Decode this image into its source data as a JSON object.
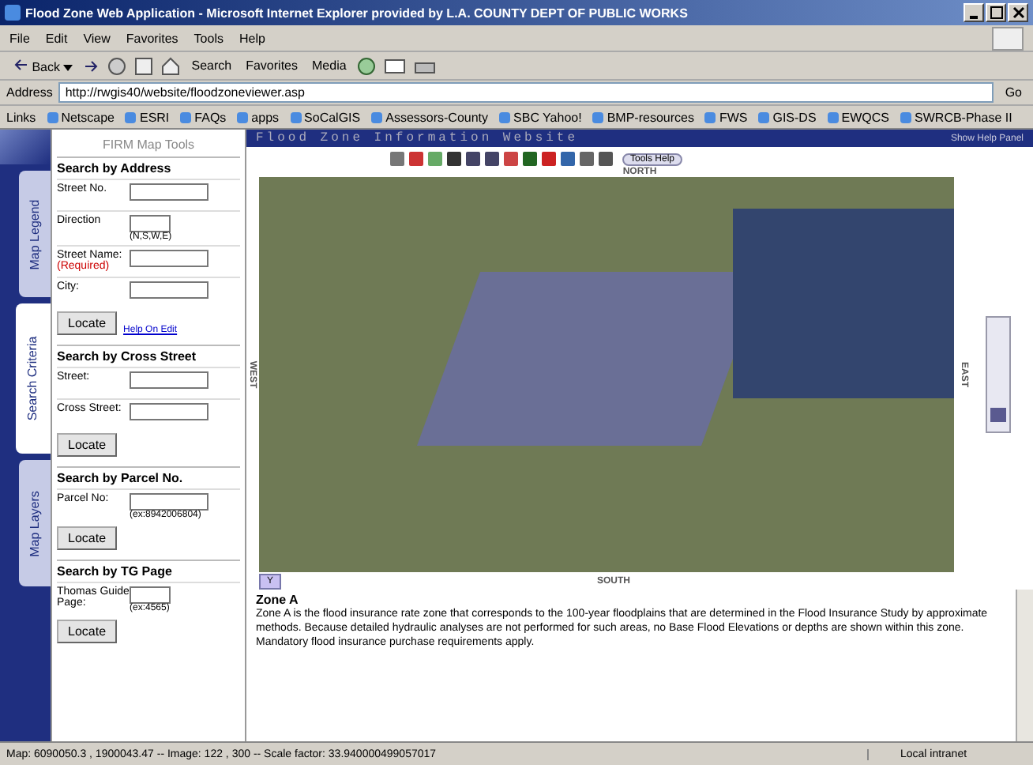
{
  "window": {
    "title": "Flood Zone Web Application - Microsoft Internet Explorer provided by L.A. COUNTY DEPT OF PUBLIC WORKS"
  },
  "menu": [
    "File",
    "Edit",
    "View",
    "Favorites",
    "Tools",
    "Help"
  ],
  "toolbar": {
    "back": "Back",
    "search": "Search",
    "favorites": "Favorites",
    "media": "Media"
  },
  "address": {
    "label": "Address",
    "value": "http://rwgis40/website/floodzoneviewer.asp",
    "go": "Go"
  },
  "links": {
    "label": "Links",
    "items": [
      "Netscape",
      "ESRI",
      "FAQs",
      "apps",
      "SoCalGIS",
      "Assessors-County",
      "SBC Yahoo!",
      "BMP-resources",
      "FWS",
      "GIS-DS",
      "EWQCS",
      "SWRCB-Phase II"
    ]
  },
  "side_tabs": [
    {
      "label": "Map Legend",
      "selected": false
    },
    {
      "label": "Search Criteria",
      "selected": true
    },
    {
      "label": "Map Layers",
      "selected": false
    }
  ],
  "panel": {
    "title": "FIRM Map Tools",
    "sections": [
      {
        "title": "Search by Address",
        "fields": [
          {
            "label": "Street No."
          },
          {
            "label": "Direction",
            "hint": "(N,S,W,E)",
            "short": true
          },
          {
            "label": "Street Name:",
            "required": "(Required)"
          },
          {
            "label": "City:"
          }
        ],
        "button": "Locate",
        "link": "Help On Edit"
      },
      {
        "title": "Search by Cross Street",
        "fields": [
          {
            "label": "Street:"
          },
          {
            "label": "Cross Street:"
          }
        ],
        "button": "Locate"
      },
      {
        "title": "Search by Parcel No.",
        "fields": [
          {
            "label": "Parcel No:",
            "hint": "(ex:8942006804)"
          }
        ],
        "button": "Locate"
      },
      {
        "title": "Search by TG Page",
        "fields": [
          {
            "label": "Thomas Guide Page:",
            "hint": "(ex:4565)",
            "short": true
          }
        ],
        "button": "Locate"
      }
    ]
  },
  "banner": {
    "title": "Flood Zone Information Website",
    "right": "Show Help Panel"
  },
  "tools_help": "Tools Help",
  "map": {
    "north": "NORTH",
    "south": "SOUTH",
    "west": "WEST",
    "east": "EAST",
    "zoom": {
      "level": 0.15
    },
    "y_button": "Y"
  },
  "zone": {
    "title": "Zone A",
    "text": "Zone A is the flood insurance rate zone that corresponds to the 100-year floodplains that are determined in the Flood Insurance Study by approximate methods. Because detailed hydraulic analyses are not performed for such areas, no Base Flood Elevations or depths are shown within this zone. Mandatory flood insurance purchase requirements apply."
  },
  "status_bar": {
    "text": "Map: 6090050.3 , 1900043.47 -- Image: 122 , 300 -- Scale factor: 33.940000499057017",
    "zone": "Local intranet"
  }
}
